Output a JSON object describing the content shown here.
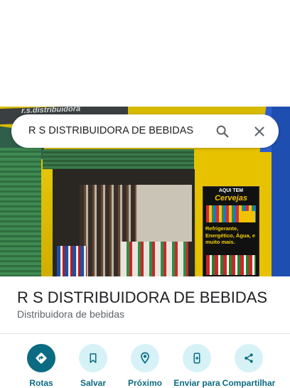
{
  "search": {
    "query": "R S DISTRIBUIDORA DE BEBIDAS"
  },
  "photo": {
    "banner_text": "r.s.distribuidora",
    "poster": {
      "line1": "AQUI TEM",
      "line2": "Cervejas",
      "line3": "Refrigerante, Energético, Água, e muito mais."
    }
  },
  "place": {
    "name": "R S DISTRIBUIDORA DE BEBIDAS",
    "category": "Distribuidora de bebidas"
  },
  "actions": [
    {
      "label": "Rotas",
      "icon": "directions-icon"
    },
    {
      "label": "Salvar",
      "icon": "bookmark-icon"
    },
    {
      "label": "Próximo",
      "icon": "nearby-icon"
    },
    {
      "label": "Enviar para",
      "icon": "send-to-phone-icon"
    },
    {
      "label": "Compartilhar",
      "icon": "share-icon"
    }
  ],
  "colors": {
    "accent": "#0b6b82",
    "accent_light": "#d6f2f7"
  }
}
